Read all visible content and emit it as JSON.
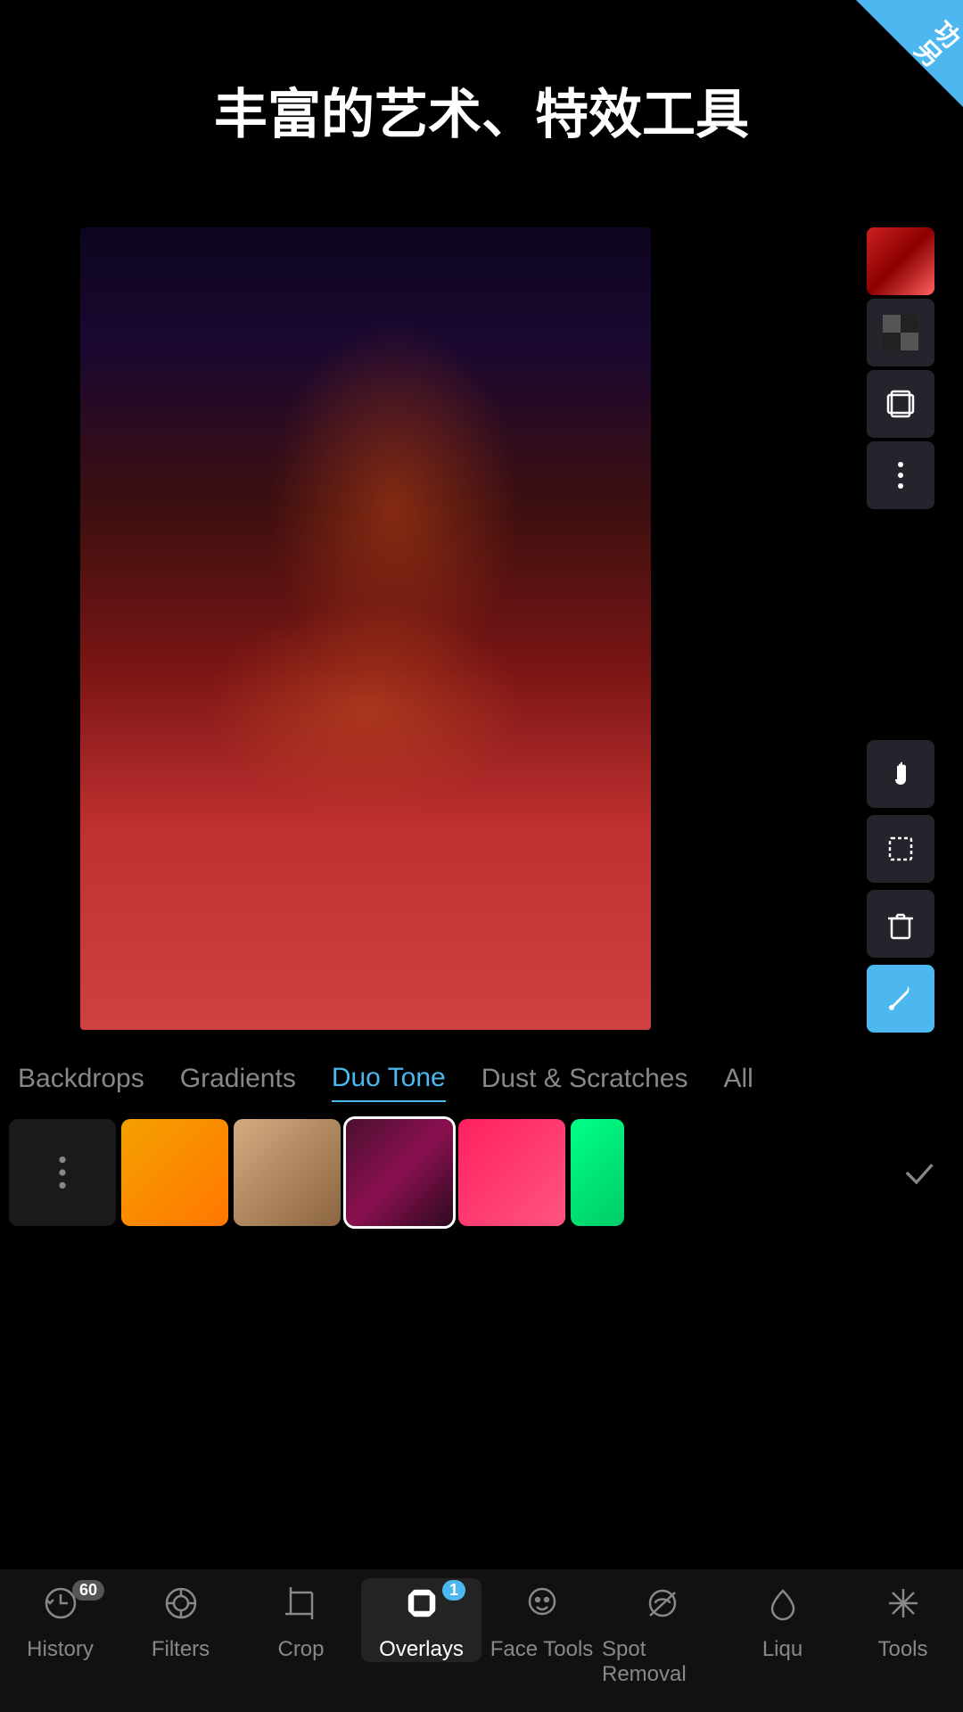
{
  "app": {
    "corner_badge": "功\n另",
    "header_title": "丰富的艺术、特效工具"
  },
  "filter_tabs": {
    "items": [
      {
        "label": "Backdrops",
        "active": false
      },
      {
        "label": "Gradients",
        "active": false
      },
      {
        "label": "Duo Tone",
        "active": true
      },
      {
        "label": "Dust & Scratches",
        "active": false
      },
      {
        "label": "All",
        "active": false
      }
    ]
  },
  "swatches": [
    {
      "id": "more",
      "type": "more"
    },
    {
      "id": "orange",
      "color": "#f5a000",
      "type": "solid"
    },
    {
      "id": "tan",
      "color": "#c4956a",
      "type": "gradient"
    },
    {
      "id": "dark-red",
      "color": "#4a1030",
      "type": "gradient",
      "selected": true
    },
    {
      "id": "pink-red",
      "color": "#ff2060",
      "type": "gradient"
    },
    {
      "id": "teal-green",
      "color": "#00ff88",
      "type": "partial"
    }
  ],
  "bottom_nav": {
    "items": [
      {
        "id": "history",
        "label": "History",
        "badge": "60",
        "icon": "history",
        "active": false
      },
      {
        "id": "filters",
        "label": "Filters",
        "icon": "filters",
        "active": false
      },
      {
        "id": "crop",
        "label": "Crop",
        "icon": "crop",
        "active": false
      },
      {
        "id": "overlays",
        "label": "Overlays",
        "icon": "overlays",
        "active": true,
        "badge_blue": "1"
      },
      {
        "id": "face-tools",
        "label": "Face Tools",
        "icon": "face",
        "active": false
      },
      {
        "id": "spot-removal",
        "label": "Spot Removal",
        "icon": "spot",
        "active": false
      },
      {
        "id": "liqu",
        "label": "Liqu",
        "icon": "liqu",
        "active": false
      },
      {
        "id": "tools",
        "label": "Tools",
        "icon": "tools",
        "active": false
      }
    ]
  },
  "right_tools": {
    "top": [
      "color-swatch",
      "checker",
      "layers",
      "more"
    ],
    "bottom": [
      "hand",
      "select",
      "trash",
      "eyedropper"
    ]
  }
}
